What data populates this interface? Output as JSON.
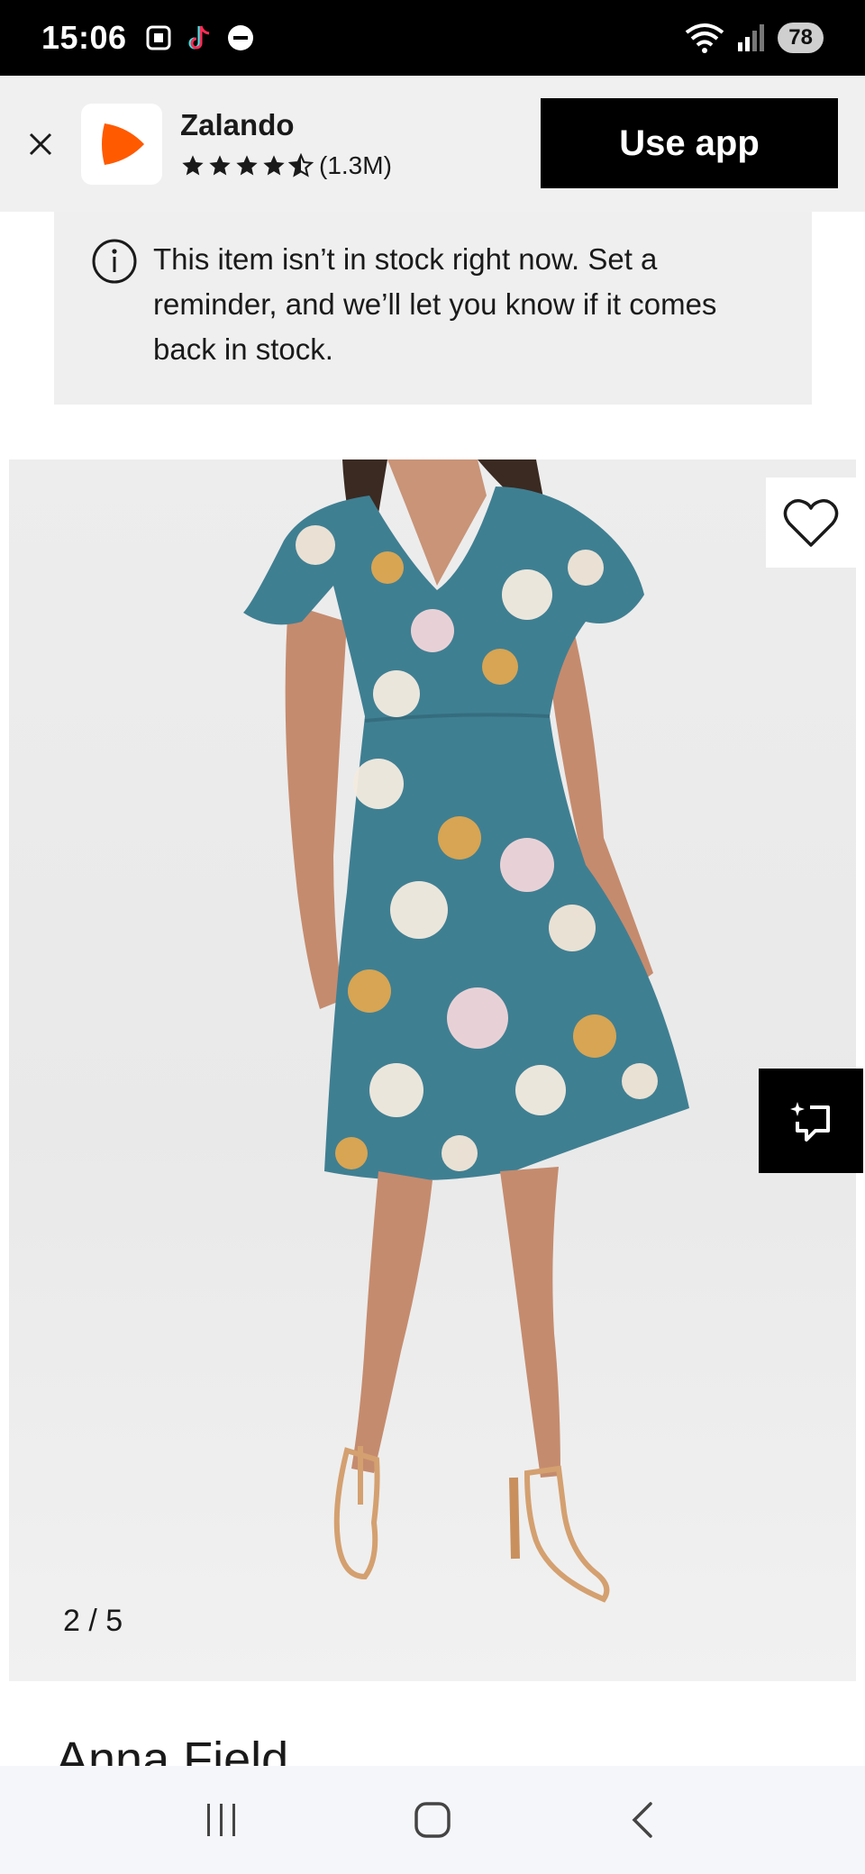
{
  "status_bar": {
    "time": "15:06",
    "battery": "78",
    "icons": [
      "screenshot-icon",
      "tiktok-icon",
      "dnd-icon",
      "wifi-icon",
      "signal-icon",
      "battery-icon"
    ]
  },
  "app_banner": {
    "app_name": "Zalando",
    "rating_count": "(1.3M)",
    "rating_stars": 4.5,
    "cta_label": "Use app",
    "brand_color": "#ff5a00"
  },
  "notice": {
    "message": "This item isn’t in stock right now. Set a reminder, and we’ll let you know if it comes back in stock."
  },
  "gallery": {
    "counter": "2 / 5",
    "dress_color": "#3f7f92"
  },
  "product": {
    "brand_peek": "Anna Field"
  },
  "nav_bar": {
    "icons": [
      "recent-apps-icon",
      "home-icon",
      "back-icon"
    ]
  }
}
